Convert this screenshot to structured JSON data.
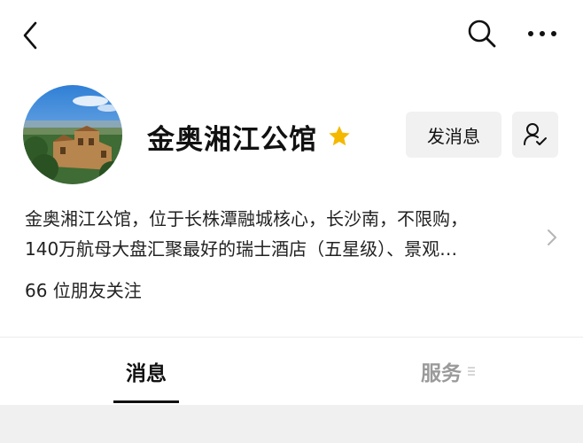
{
  "nav": {
    "back_icon": "chevron-left-icon",
    "search_icon": "search-icon",
    "more_icon": "more-dots-icon"
  },
  "profile": {
    "name": "金奥湘江公馆",
    "star_color": "#F5B800",
    "message_button": "发消息",
    "follow_icon": "user-check-icon",
    "description_line1": "金奥湘江公馆，位于长株潭融城核心，长沙南，不限购，",
    "description_line2": "140万航母大盘汇聚最好的瑞士酒店（五星级）、景观…",
    "followers": "66 位朋友关注"
  },
  "tabs": [
    {
      "label": "消息",
      "active": true
    },
    {
      "label": "服务",
      "active": false
    }
  ],
  "colors": {
    "button_bg": "#F1F1F1",
    "inactive_tab": "#9A9A9A",
    "bottom_bg": "#F0F0F0"
  }
}
